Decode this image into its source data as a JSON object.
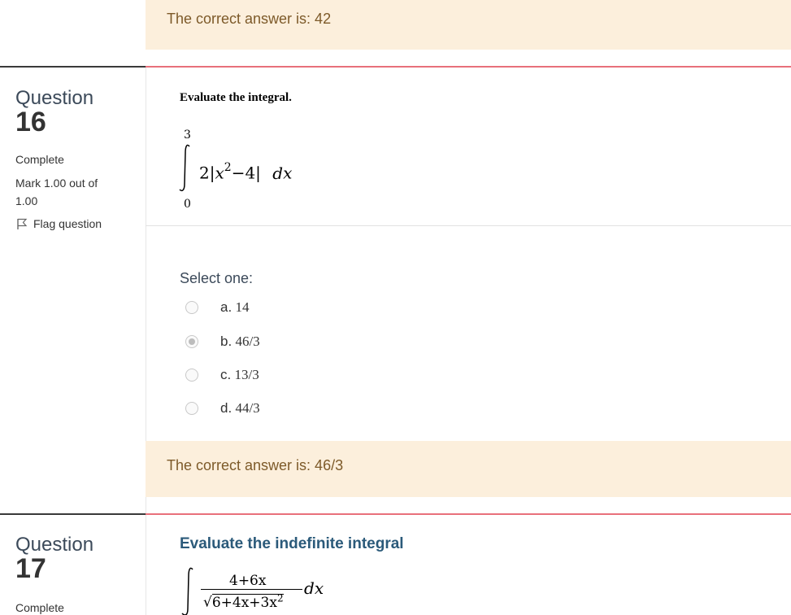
{
  "top_feedback": {
    "text": "The correct answer is: 42"
  },
  "q16": {
    "word": "Question",
    "number": "16",
    "state": "Complete",
    "mark": "Mark 1.00 out of 1.00",
    "flag_label": "Flag question",
    "prompt": "Evaluate the integral.",
    "integral": {
      "upper": "3",
      "lower": "0",
      "coef": "2",
      "var": "x",
      "exp": "2",
      "rest": "−4",
      "dx": "d"
    },
    "select_label": "Select one:",
    "options": [
      {
        "letter": "a.",
        "value": "14",
        "checked": false
      },
      {
        "letter": "b.",
        "value": "46/3",
        "checked": true
      },
      {
        "letter": "c.",
        "value": "13/3",
        "checked": false
      },
      {
        "letter": "d.",
        "value": "44/3",
        "checked": false
      }
    ],
    "feedback": "The correct answer is: 46/3"
  },
  "q17": {
    "word": "Question",
    "number": "17",
    "state": "Complete",
    "prompt": "Evaluate the indefinite integral",
    "integral": {
      "numerator": "4+6x",
      "denominator": "6+4x+3x",
      "exp": "2",
      "dx": "d",
      "var": "x"
    }
  }
}
